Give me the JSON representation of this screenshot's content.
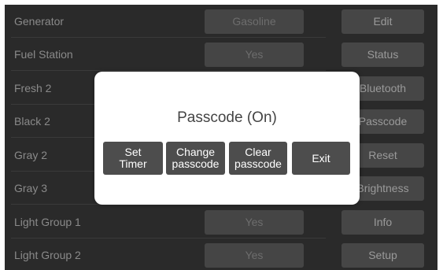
{
  "rows": [
    {
      "label": "Generator",
      "value": "Gasoline",
      "menu": "Edit"
    },
    {
      "label": "Fuel Station",
      "value": "Yes",
      "menu": "Status"
    },
    {
      "label": "Fresh 2",
      "value": "",
      "menu": "Bluetooth"
    },
    {
      "label": "Black 2",
      "value": "",
      "menu": "Passcode"
    },
    {
      "label": "Gray 2",
      "value": "",
      "menu": "Reset"
    },
    {
      "label": "Gray 3",
      "value": "",
      "menu": "Brightness"
    },
    {
      "label": "Light Group 1",
      "value": "Yes",
      "menu": "Info"
    },
    {
      "label": "Light Group 2",
      "value": "Yes",
      "menu": "Setup"
    }
  ],
  "dialog": {
    "title": "Passcode (On)",
    "buttons": {
      "set_timer": "Set\nTimer",
      "change_passcode": "Change\npasscode",
      "clear_passcode": "Clear\npasscode",
      "exit": "Exit"
    }
  },
  "colors": {
    "screen_bg": "#2a2a2a",
    "button_bg": "#464646",
    "dialog_button_bg": "#4d4d4d",
    "dialog_bg": "#ffffff"
  }
}
